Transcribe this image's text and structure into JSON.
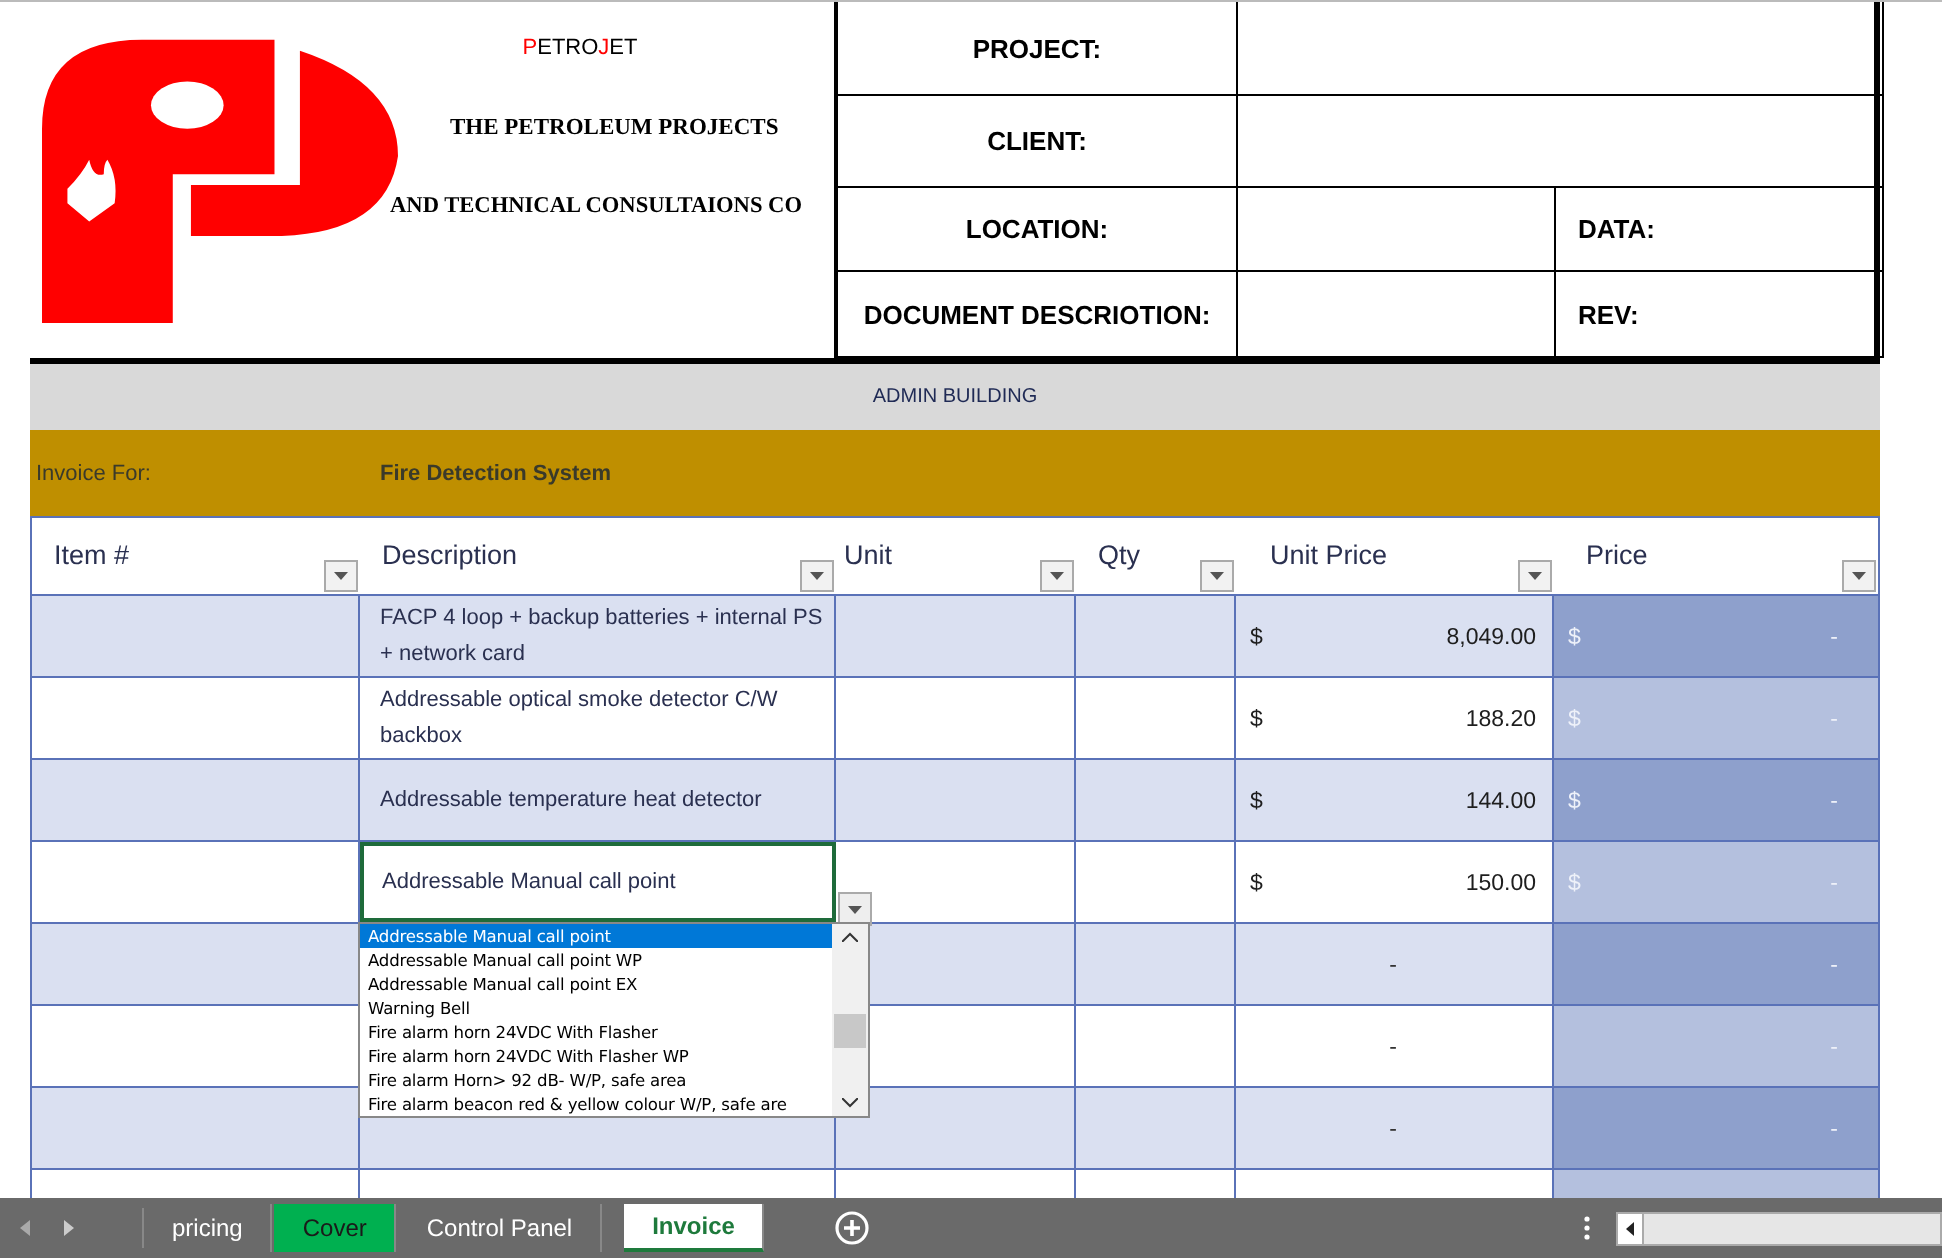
{
  "company": {
    "name_parts": [
      {
        "text": "P",
        "color": "#ff0000"
      },
      {
        "text": "ETRO",
        "color": "#000000"
      },
      {
        "text": "J",
        "color": "#ff0000"
      },
      {
        "text": "ET",
        "color": "#000000"
      }
    ],
    "line_1": "THE PETROLEUM PROJECTS",
    "line_2": "AND TECHNICAL CONSULTAIONS CO"
  },
  "info": {
    "project_label": "PROJECT:",
    "client_label": "CLIENT:",
    "location_label": "LOCATION:",
    "date_label": "DATA:",
    "description_label": "DOCUMENT DESCRIOTION:",
    "rev_label": "REV:"
  },
  "section_title": "ADMIN BUILDING",
  "invoice_for": {
    "label": "Invoice For:",
    "value": "Fire Detection System"
  },
  "table": {
    "columns": [
      "Item #",
      "Description",
      "Unit",
      "Qty",
      "Unit Price",
      "Price"
    ],
    "rows": [
      {
        "description": "FACP 4 loop + backup batteries + internal PS + network card",
        "unit_price": {
          "currency": "$",
          "amount": "8,049.00"
        },
        "price": {
          "currency": "$",
          "amount": "-"
        }
      },
      {
        "description": "Addressable optical smoke detector C/W backbox",
        "unit_price": {
          "currency": "$",
          "amount": "188.20"
        },
        "price": {
          "currency": "$",
          "amount": "-"
        }
      },
      {
        "description": "Addressable temperature heat detector",
        "unit_price": {
          "currency": "$",
          "amount": "144.00"
        },
        "price": {
          "currency": "$",
          "amount": "-"
        }
      },
      {
        "description": "Addressable Manual call point",
        "unit_price": {
          "currency": "$",
          "amount": "150.00"
        },
        "price": {
          "currency": "$",
          "amount": "-"
        },
        "active": true
      },
      {
        "unit_price": {
          "amount": "-"
        },
        "price": {
          "amount": "-"
        }
      },
      {
        "unit_price": {
          "amount": "-"
        },
        "price": {
          "amount": "-"
        }
      },
      {
        "unit_price": {
          "amount": "-"
        },
        "price": {
          "amount": "-"
        }
      },
      {}
    ]
  },
  "dropdown": {
    "options": [
      {
        "label": "Addressable Manual call point",
        "selected": true
      },
      {
        "label": "Addressable Manual call point WP",
        "selected": false
      },
      {
        "label": "Addressable Manual call point EX",
        "selected": false
      },
      {
        "label": "Warning Bell",
        "selected": false
      },
      {
        "label": "Fire alarm horn 24VDC With Flasher",
        "selected": false
      },
      {
        "label": "Fire alarm horn 24VDC With Flasher WP",
        "selected": false
      },
      {
        "label": "Fire alarm Horn> 92 dB- W/P, safe area",
        "selected": false
      },
      {
        "label": "Fire alarm beacon red & yellow colour W/P, safe are",
        "selected": false
      }
    ]
  },
  "sheet_tabs": [
    {
      "label": "pricing",
      "selected": false
    },
    {
      "label": "Cover",
      "selected": false,
      "color": "#00b050"
    },
    {
      "label": "Control Panel",
      "selected": false
    },
    {
      "label": "Invoice",
      "selected": true
    }
  ]
}
